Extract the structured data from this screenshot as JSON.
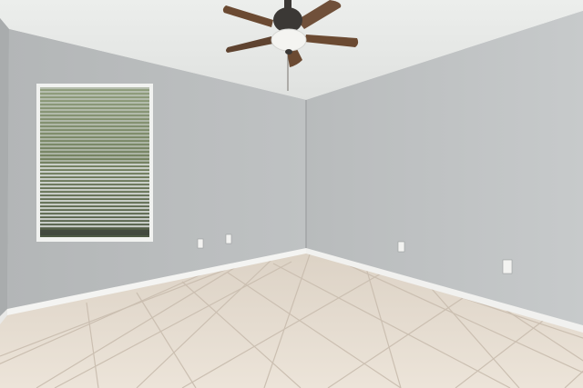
{
  "scene": {
    "subject": "empty room",
    "features": [
      "ceiling-fan",
      "window-with-blinds",
      "electrical-outlets",
      "tile-floor",
      "baseboards"
    ]
  },
  "colors": {
    "ceiling": "#e7e8e6",
    "left_wall": "#b9bcbd",
    "back_wall": "#aeb1b2",
    "right_wall": "#c3c6c7",
    "floor": "#e6dcd0",
    "grout": "#cbbfb1",
    "baseboard": "#f4f4f2",
    "fan_blade": "#6b4a32",
    "fan_hub": "#3b3835",
    "window_trim": "#f1f2f0",
    "blinds": "#d9ddda",
    "foliage": "#6f7d5a"
  }
}
